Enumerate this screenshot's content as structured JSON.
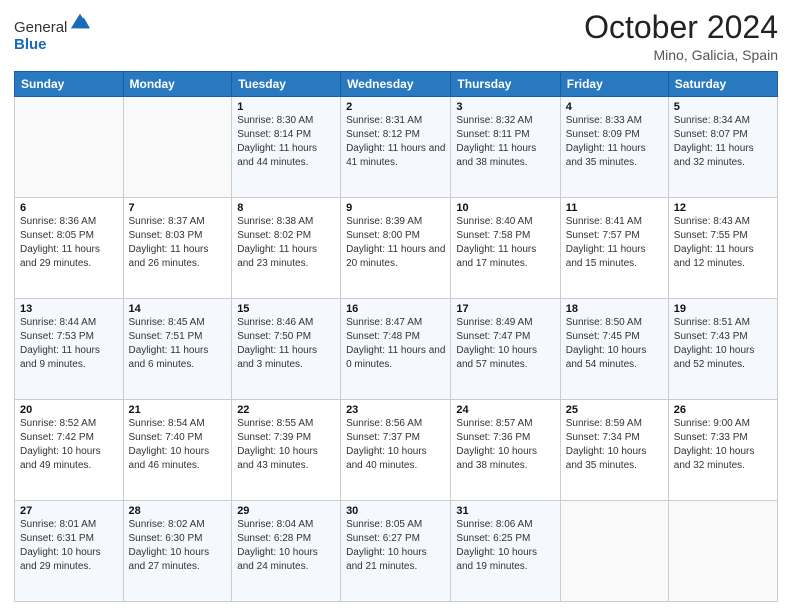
{
  "logo": {
    "general": "General",
    "blue": "Blue"
  },
  "calendar": {
    "title": "October 2024",
    "location": "Mino, Galicia, Spain",
    "weekdays": [
      "Sunday",
      "Monday",
      "Tuesday",
      "Wednesday",
      "Thursday",
      "Friday",
      "Saturday"
    ],
    "weeks": [
      [
        {
          "day": "",
          "sunrise": "",
          "sunset": "",
          "daylight": ""
        },
        {
          "day": "",
          "sunrise": "",
          "sunset": "",
          "daylight": ""
        },
        {
          "day": "1",
          "sunrise": "Sunrise: 8:30 AM",
          "sunset": "Sunset: 8:14 PM",
          "daylight": "Daylight: 11 hours and 44 minutes."
        },
        {
          "day": "2",
          "sunrise": "Sunrise: 8:31 AM",
          "sunset": "Sunset: 8:12 PM",
          "daylight": "Daylight: 11 hours and 41 minutes."
        },
        {
          "day": "3",
          "sunrise": "Sunrise: 8:32 AM",
          "sunset": "Sunset: 8:11 PM",
          "daylight": "Daylight: 11 hours and 38 minutes."
        },
        {
          "day": "4",
          "sunrise": "Sunrise: 8:33 AM",
          "sunset": "Sunset: 8:09 PM",
          "daylight": "Daylight: 11 hours and 35 minutes."
        },
        {
          "day": "5",
          "sunrise": "Sunrise: 8:34 AM",
          "sunset": "Sunset: 8:07 PM",
          "daylight": "Daylight: 11 hours and 32 minutes."
        }
      ],
      [
        {
          "day": "6",
          "sunrise": "Sunrise: 8:36 AM",
          "sunset": "Sunset: 8:05 PM",
          "daylight": "Daylight: 11 hours and 29 minutes."
        },
        {
          "day": "7",
          "sunrise": "Sunrise: 8:37 AM",
          "sunset": "Sunset: 8:03 PM",
          "daylight": "Daylight: 11 hours and 26 minutes."
        },
        {
          "day": "8",
          "sunrise": "Sunrise: 8:38 AM",
          "sunset": "Sunset: 8:02 PM",
          "daylight": "Daylight: 11 hours and 23 minutes."
        },
        {
          "day": "9",
          "sunrise": "Sunrise: 8:39 AM",
          "sunset": "Sunset: 8:00 PM",
          "daylight": "Daylight: 11 hours and 20 minutes."
        },
        {
          "day": "10",
          "sunrise": "Sunrise: 8:40 AM",
          "sunset": "Sunset: 7:58 PM",
          "daylight": "Daylight: 11 hours and 17 minutes."
        },
        {
          "day": "11",
          "sunrise": "Sunrise: 8:41 AM",
          "sunset": "Sunset: 7:57 PM",
          "daylight": "Daylight: 11 hours and 15 minutes."
        },
        {
          "day": "12",
          "sunrise": "Sunrise: 8:43 AM",
          "sunset": "Sunset: 7:55 PM",
          "daylight": "Daylight: 11 hours and 12 minutes."
        }
      ],
      [
        {
          "day": "13",
          "sunrise": "Sunrise: 8:44 AM",
          "sunset": "Sunset: 7:53 PM",
          "daylight": "Daylight: 11 hours and 9 minutes."
        },
        {
          "day": "14",
          "sunrise": "Sunrise: 8:45 AM",
          "sunset": "Sunset: 7:51 PM",
          "daylight": "Daylight: 11 hours and 6 minutes."
        },
        {
          "day": "15",
          "sunrise": "Sunrise: 8:46 AM",
          "sunset": "Sunset: 7:50 PM",
          "daylight": "Daylight: 11 hours and 3 minutes."
        },
        {
          "day": "16",
          "sunrise": "Sunrise: 8:47 AM",
          "sunset": "Sunset: 7:48 PM",
          "daylight": "Daylight: 11 hours and 0 minutes."
        },
        {
          "day": "17",
          "sunrise": "Sunrise: 8:49 AM",
          "sunset": "Sunset: 7:47 PM",
          "daylight": "Daylight: 10 hours and 57 minutes."
        },
        {
          "day": "18",
          "sunrise": "Sunrise: 8:50 AM",
          "sunset": "Sunset: 7:45 PM",
          "daylight": "Daylight: 10 hours and 54 minutes."
        },
        {
          "day": "19",
          "sunrise": "Sunrise: 8:51 AM",
          "sunset": "Sunset: 7:43 PM",
          "daylight": "Daylight: 10 hours and 52 minutes."
        }
      ],
      [
        {
          "day": "20",
          "sunrise": "Sunrise: 8:52 AM",
          "sunset": "Sunset: 7:42 PM",
          "daylight": "Daylight: 10 hours and 49 minutes."
        },
        {
          "day": "21",
          "sunrise": "Sunrise: 8:54 AM",
          "sunset": "Sunset: 7:40 PM",
          "daylight": "Daylight: 10 hours and 46 minutes."
        },
        {
          "day": "22",
          "sunrise": "Sunrise: 8:55 AM",
          "sunset": "Sunset: 7:39 PM",
          "daylight": "Daylight: 10 hours and 43 minutes."
        },
        {
          "day": "23",
          "sunrise": "Sunrise: 8:56 AM",
          "sunset": "Sunset: 7:37 PM",
          "daylight": "Daylight: 10 hours and 40 minutes."
        },
        {
          "day": "24",
          "sunrise": "Sunrise: 8:57 AM",
          "sunset": "Sunset: 7:36 PM",
          "daylight": "Daylight: 10 hours and 38 minutes."
        },
        {
          "day": "25",
          "sunrise": "Sunrise: 8:59 AM",
          "sunset": "Sunset: 7:34 PM",
          "daylight": "Daylight: 10 hours and 35 minutes."
        },
        {
          "day": "26",
          "sunrise": "Sunrise: 9:00 AM",
          "sunset": "Sunset: 7:33 PM",
          "daylight": "Daylight: 10 hours and 32 minutes."
        }
      ],
      [
        {
          "day": "27",
          "sunrise": "Sunrise: 8:01 AM",
          "sunset": "Sunset: 6:31 PM",
          "daylight": "Daylight: 10 hours and 29 minutes."
        },
        {
          "day": "28",
          "sunrise": "Sunrise: 8:02 AM",
          "sunset": "Sunset: 6:30 PM",
          "daylight": "Daylight: 10 hours and 27 minutes."
        },
        {
          "day": "29",
          "sunrise": "Sunrise: 8:04 AM",
          "sunset": "Sunset: 6:28 PM",
          "daylight": "Daylight: 10 hours and 24 minutes."
        },
        {
          "day": "30",
          "sunrise": "Sunrise: 8:05 AM",
          "sunset": "Sunset: 6:27 PM",
          "daylight": "Daylight: 10 hours and 21 minutes."
        },
        {
          "day": "31",
          "sunrise": "Sunrise: 8:06 AM",
          "sunset": "Sunset: 6:25 PM",
          "daylight": "Daylight: 10 hours and 19 minutes."
        },
        {
          "day": "",
          "sunrise": "",
          "sunset": "",
          "daylight": ""
        },
        {
          "day": "",
          "sunrise": "",
          "sunset": "",
          "daylight": ""
        }
      ]
    ]
  }
}
